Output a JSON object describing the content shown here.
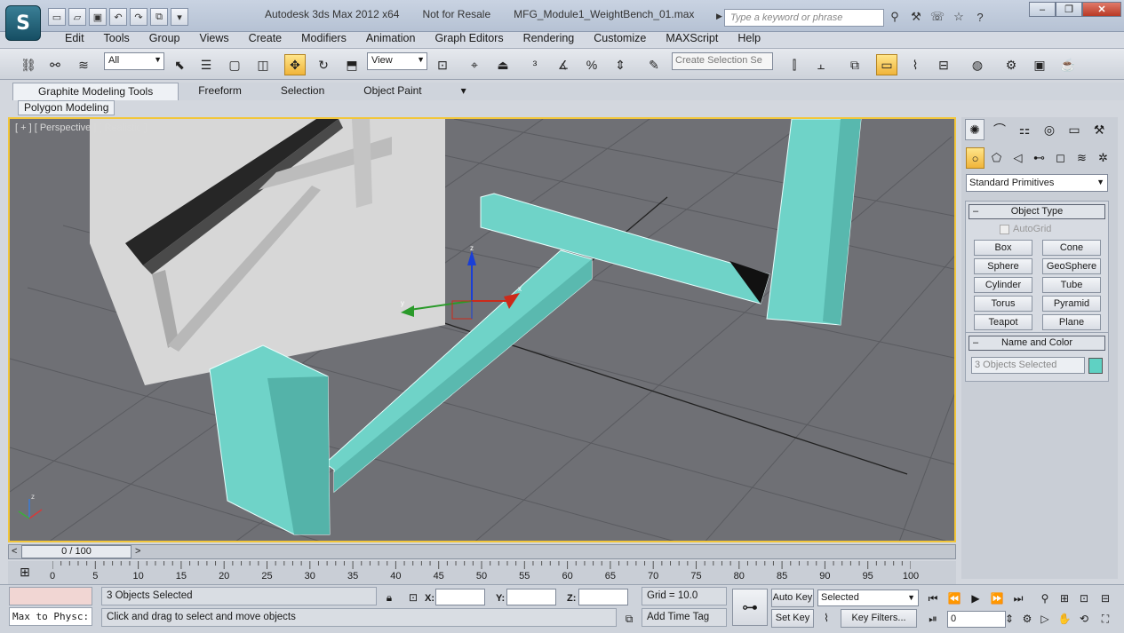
{
  "title": {
    "app": "Autodesk 3ds Max  2012 x64",
    "license": "Not for Resale",
    "file": "MFG_Module1_WeightBench_01.max",
    "search_placeholder": "Type a keyword or phrase"
  },
  "menu": [
    "Edit",
    "Tools",
    "Group",
    "Views",
    "Create",
    "Modifiers",
    "Animation",
    "Graph Editors",
    "Rendering",
    "Customize",
    "MAXScript",
    "Help"
  ],
  "toolbar": {
    "filter_value": "All",
    "ref_coord_value": "View",
    "selection_set_placeholder": "Create Selection Se"
  },
  "ribbon": {
    "tabs": [
      "Graphite Modeling Tools",
      "Freeform",
      "Selection",
      "Object Paint"
    ],
    "panel": "Polygon Modeling"
  },
  "viewport": {
    "label": "[ + ] [ Perspective ] [ Realistic ]",
    "object_color": "#6fd3c8"
  },
  "command_panel": {
    "category": "Standard Primitives",
    "object_type_title": "Object Type",
    "autogrid_label": "AutoGrid",
    "primitives": [
      "Box",
      "Cone",
      "Sphere",
      "GeoSphere",
      "Cylinder",
      "Tube",
      "Torus",
      "Pyramid",
      "Teapot",
      "Plane"
    ],
    "name_color_title": "Name and Color",
    "name_value": "3 Objects Selected",
    "swatch_color": "#5fd1c3"
  },
  "timeline": {
    "frame_display": "0 / 100",
    "ticks": [
      "0",
      "5",
      "10",
      "15",
      "20",
      "25",
      "30",
      "35",
      "40",
      "45",
      "50",
      "55",
      "60",
      "65",
      "70",
      "75",
      "80",
      "85",
      "90",
      "95",
      "100"
    ]
  },
  "status": {
    "selection_info": "3 Objects Selected",
    "prompt": "Click and drag to select and move objects",
    "listener_text": "Max to Physc:",
    "x_label": "X:",
    "y_label": "Y:",
    "z_label": "Z:",
    "grid": "Grid = 10.0",
    "add_time_tag": "Add Time Tag",
    "auto_key": "Auto Key",
    "set_key": "Set Key",
    "key_mode_value": "Selected",
    "key_filters": "Key Filters...",
    "current_frame": "0"
  }
}
